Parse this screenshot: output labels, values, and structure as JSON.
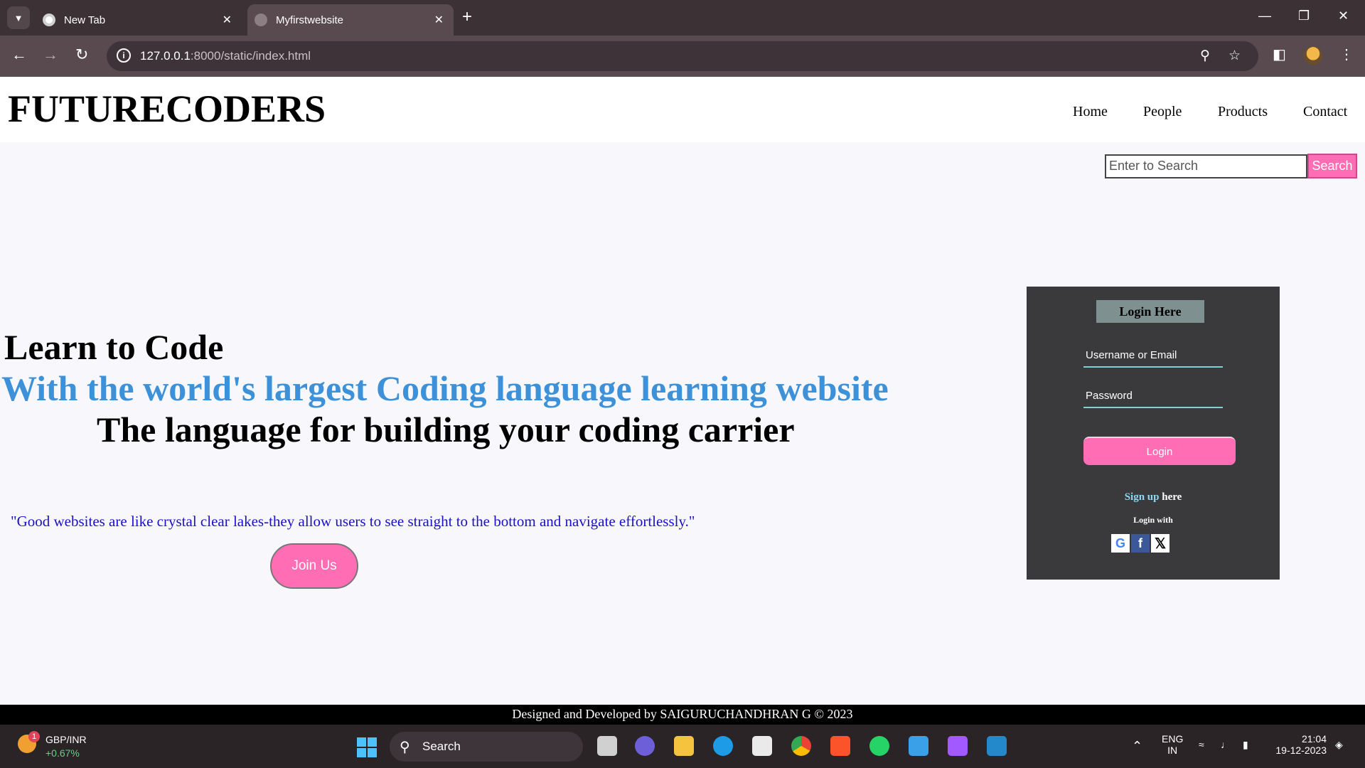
{
  "browser": {
    "tabs": [
      {
        "title": "New Tab",
        "active": false
      },
      {
        "title": "Myfirstwebsite",
        "active": true
      }
    ],
    "url_host": "127.0.0.1",
    "url_rest": ":8000/static/index.html"
  },
  "site": {
    "logo": "FUTURECODERS",
    "nav": [
      "Home",
      "People",
      "Products",
      "Contact"
    ],
    "search": {
      "placeholder": "Enter to Search",
      "button": "Search"
    },
    "hero": {
      "line1": "Learn to Code",
      "line2": "With the world's largest Coding language learning website",
      "line3": "The language for building your coding carrier"
    },
    "quote": "\"Good websites are like crystal clear lakes-they allow users to see straight to the bottom and navigate effortlessly.\"",
    "join_button": "Join Us",
    "login": {
      "title": "Login Here",
      "username_placeholder": "Username or Email",
      "password_placeholder": "Password",
      "button": "Login",
      "signup_link": "Sign up",
      "signup_rest": " here",
      "login_with": "Login with"
    },
    "footer": "Designed and Developed by SAIGURUCHANDHRAN G © 2023"
  },
  "taskbar": {
    "widget_name": "GBP/INR",
    "widget_value": "+0.67%",
    "widget_badge": "1",
    "search_label": "Search",
    "lang_line1": "ENG",
    "lang_line2": "IN",
    "time": "21:04",
    "date": "19-12-2023"
  },
  "colors": {
    "accent_pink": "#ff6eb4",
    "hero_blue": "#3d91d8",
    "quote_blue": "#1a10c8",
    "login_panel": "#3a3a3c"
  }
}
